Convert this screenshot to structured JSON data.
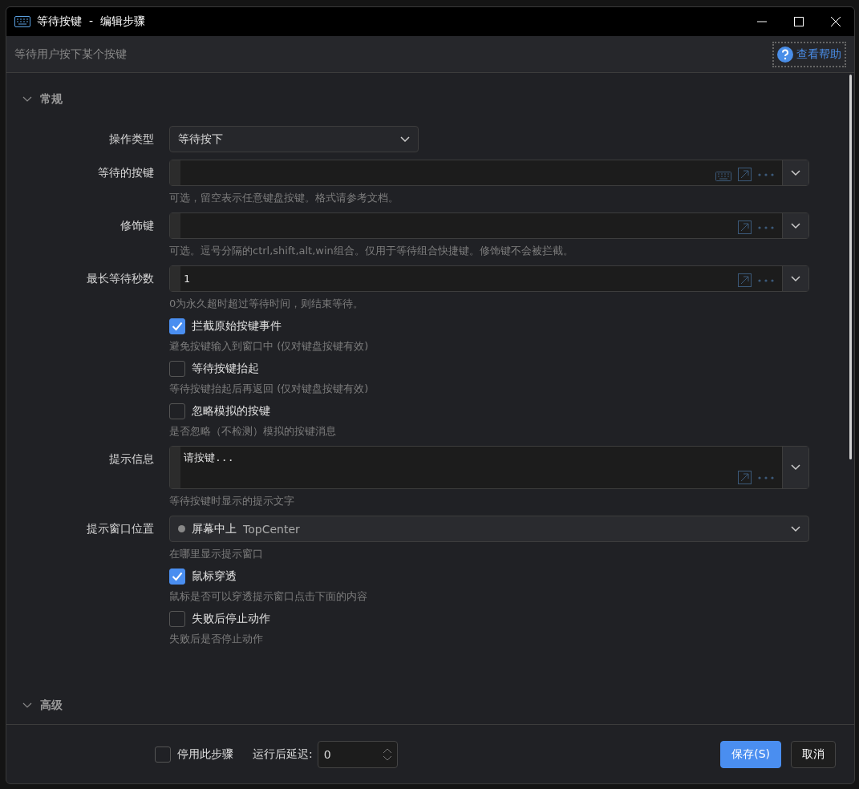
{
  "window": {
    "title": "等待按键  -  编辑步骤"
  },
  "subtitle": "等待用户按下某个按键",
  "help_link": "查看帮助",
  "sections": [
    {
      "title": "常规",
      "fields": [
        {
          "kind": "select",
          "label": "操作类型",
          "value": "等待按下"
        },
        {
          "kind": "input",
          "label": "等待的按键",
          "keyboard_button": true,
          "hint": "可选，留空表示任意键盘按键。格式请参考文档。"
        },
        {
          "kind": "input",
          "label": "修饰键",
          "keyboard_button": false,
          "hint": "可选。逗号分隔的ctrl,shift,alt,win组合。仅用于等待组合快捷键。修饰键不会被拦截。"
        },
        {
          "kind": "input",
          "label": "最长等待秒数",
          "value": "1",
          "keyboard_button": false,
          "hint": "0为永久超时超过等待时间，则结束等待。"
        },
        {
          "kind": "checkbox",
          "label": "拦截原始按键事件",
          "checked": true,
          "hint": "避免按键输入到窗口中 (仅对键盘按键有效)"
        },
        {
          "kind": "checkbox",
          "label": "等待按键抬起",
          "checked": false,
          "hint": "等待按键抬起后再返回 (仅对键盘按键有效)"
        },
        {
          "kind": "checkbox",
          "label": "忽略模拟的按键",
          "checked": false,
          "hint": "是否忽略（不检测）模拟的按键消息"
        },
        {
          "kind": "textarea",
          "label": "提示信息",
          "value": "请按键...",
          "hint": "等待按键时显示的提示文字"
        },
        {
          "kind": "enum",
          "label": "提示窗口位置",
          "value": "屏幕中上",
          "value_en": "TopCenter",
          "hint": "在哪里显示提示窗口"
        },
        {
          "kind": "checkbox",
          "label": "鼠标穿透",
          "checked": true,
          "hint": "鼠标是否可以穿透提示窗口点击下面的内容"
        },
        {
          "kind": "checkbox",
          "label": "失败后停止动作",
          "checked": false,
          "hint": "失败后是否停止动作"
        }
      ]
    },
    {
      "title": "高级"
    }
  ],
  "footer": {
    "disable_step": {
      "label": "停用此步骤",
      "checked": false
    },
    "delay_label": "运行后延迟:",
    "delay_value": "0",
    "buttons": [
      {
        "label": "保存(S)",
        "primary": true
      },
      {
        "label": "取消",
        "primary": false
      }
    ]
  }
}
